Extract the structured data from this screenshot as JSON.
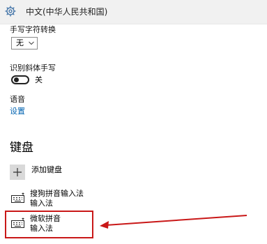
{
  "header": {
    "title": "中文(中华人民共和国)",
    "icon": "gear-icon"
  },
  "handwriting_conversion": {
    "label": "手写字符转换",
    "selected": "无"
  },
  "italic_handwriting": {
    "label": "识别斜体手写",
    "state": "关",
    "on": false
  },
  "speech": {
    "label": "语音",
    "link": "设置"
  },
  "keyboards": {
    "title": "键盘",
    "add_label": "添加键盘",
    "items": [
      {
        "name": "搜狗拼音输入法",
        "type": "输入法",
        "icon": "keyboard-icon"
      },
      {
        "name": "微软拼音",
        "type": "输入法",
        "icon": "keyboard-icon"
      }
    ]
  },
  "colors": {
    "accent": "#0063b1",
    "annotation": "#c91818"
  }
}
